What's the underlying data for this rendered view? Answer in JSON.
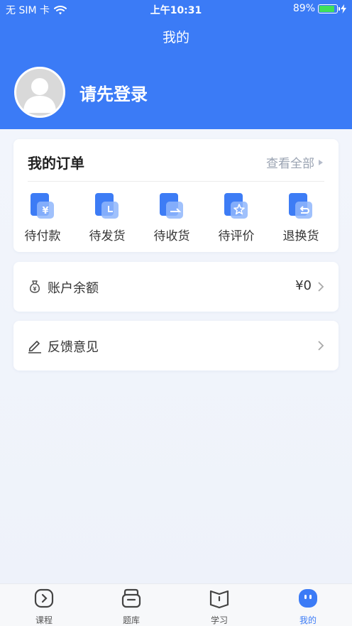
{
  "status_bar": {
    "carrier": "无 SIM 卡",
    "time": "上午10:31",
    "battery": "89%",
    "battery_level": 0.89
  },
  "header": {
    "title": "我的",
    "login_prompt": "请先登录"
  },
  "orders": {
    "title": "我的订单",
    "view_all": "查看全部",
    "items": [
      {
        "label": "待付款",
        "icon": "yen-icon"
      },
      {
        "label": "待发货",
        "icon": "clock-icon"
      },
      {
        "label": "待收货",
        "icon": "receive-icon"
      },
      {
        "label": "待评价",
        "icon": "star-icon"
      },
      {
        "label": "退换货",
        "icon": "return-icon"
      }
    ]
  },
  "balance": {
    "label": "账户余额",
    "value": "¥0",
    "icon": "money-bag-icon"
  },
  "feedback": {
    "label": "反馈意见",
    "icon": "pencil-icon"
  },
  "tabbar": {
    "items": [
      {
        "label": "课程",
        "icon": "play-icon"
      },
      {
        "label": "题库",
        "icon": "question-bank-icon"
      },
      {
        "label": "学习",
        "icon": "book-icon"
      },
      {
        "label": "我的",
        "icon": "profile-icon",
        "active": true
      }
    ]
  },
  "colors": {
    "primary": "#3b7bf6",
    "background": "#f3f6fc",
    "battery": "#3fe05a"
  }
}
